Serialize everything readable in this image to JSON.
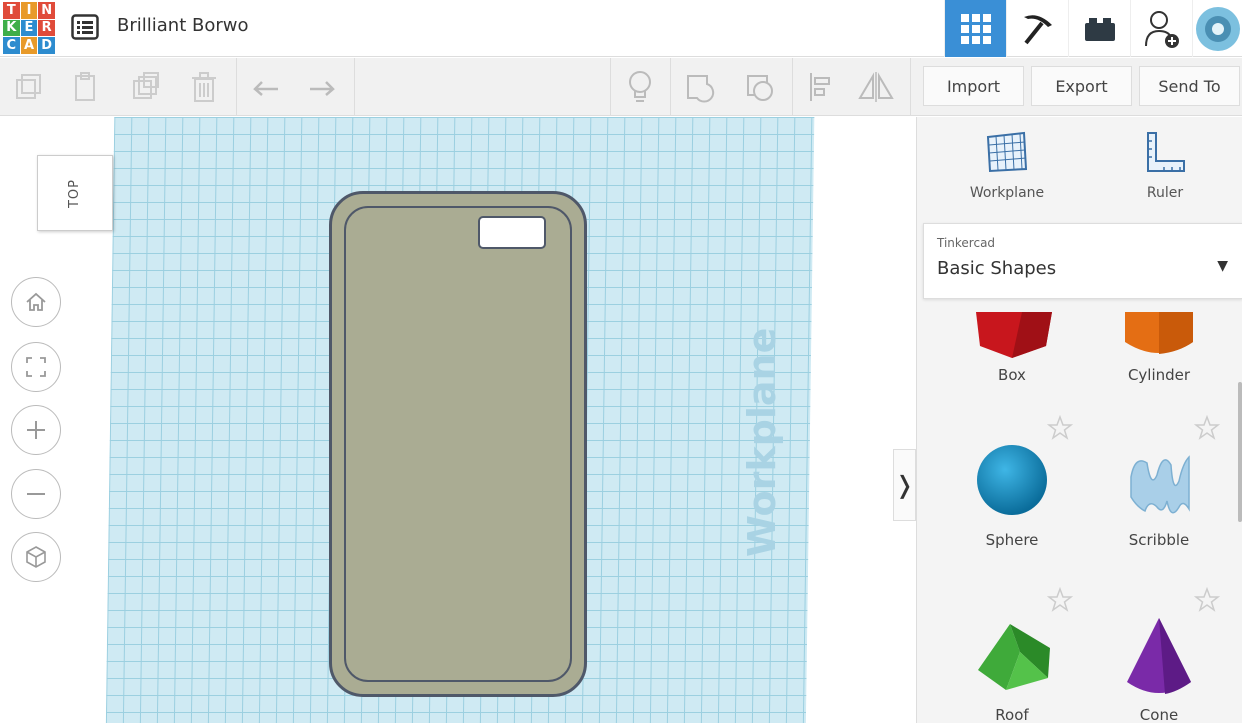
{
  "logo": {
    "letters": [
      "T",
      "I",
      "N",
      "K",
      "E",
      "R",
      "C",
      "A",
      "D"
    ]
  },
  "project_title": "Brilliant Borwo",
  "colors": {
    "accent": "#3a8fd6",
    "grid": "#cfeaf3",
    "object": "#aaac93",
    "outline": "#4f5869"
  },
  "toolbar": {
    "import_label": "Import",
    "export_label": "Export",
    "send_to_label": "Send To"
  },
  "canvas": {
    "workplane_watermark": "Workplane",
    "view_cube_label": "TOP"
  },
  "panel": {
    "workplane_label": "Workplane",
    "ruler_label": "Ruler",
    "library_source": "Tinkercad",
    "library_name": "Basic Shapes",
    "shapes": [
      {
        "label": "Box"
      },
      {
        "label": "Cylinder"
      },
      {
        "label": "Sphere"
      },
      {
        "label": "Scribble"
      },
      {
        "label": "Roof"
      },
      {
        "label": "Cone"
      }
    ]
  }
}
